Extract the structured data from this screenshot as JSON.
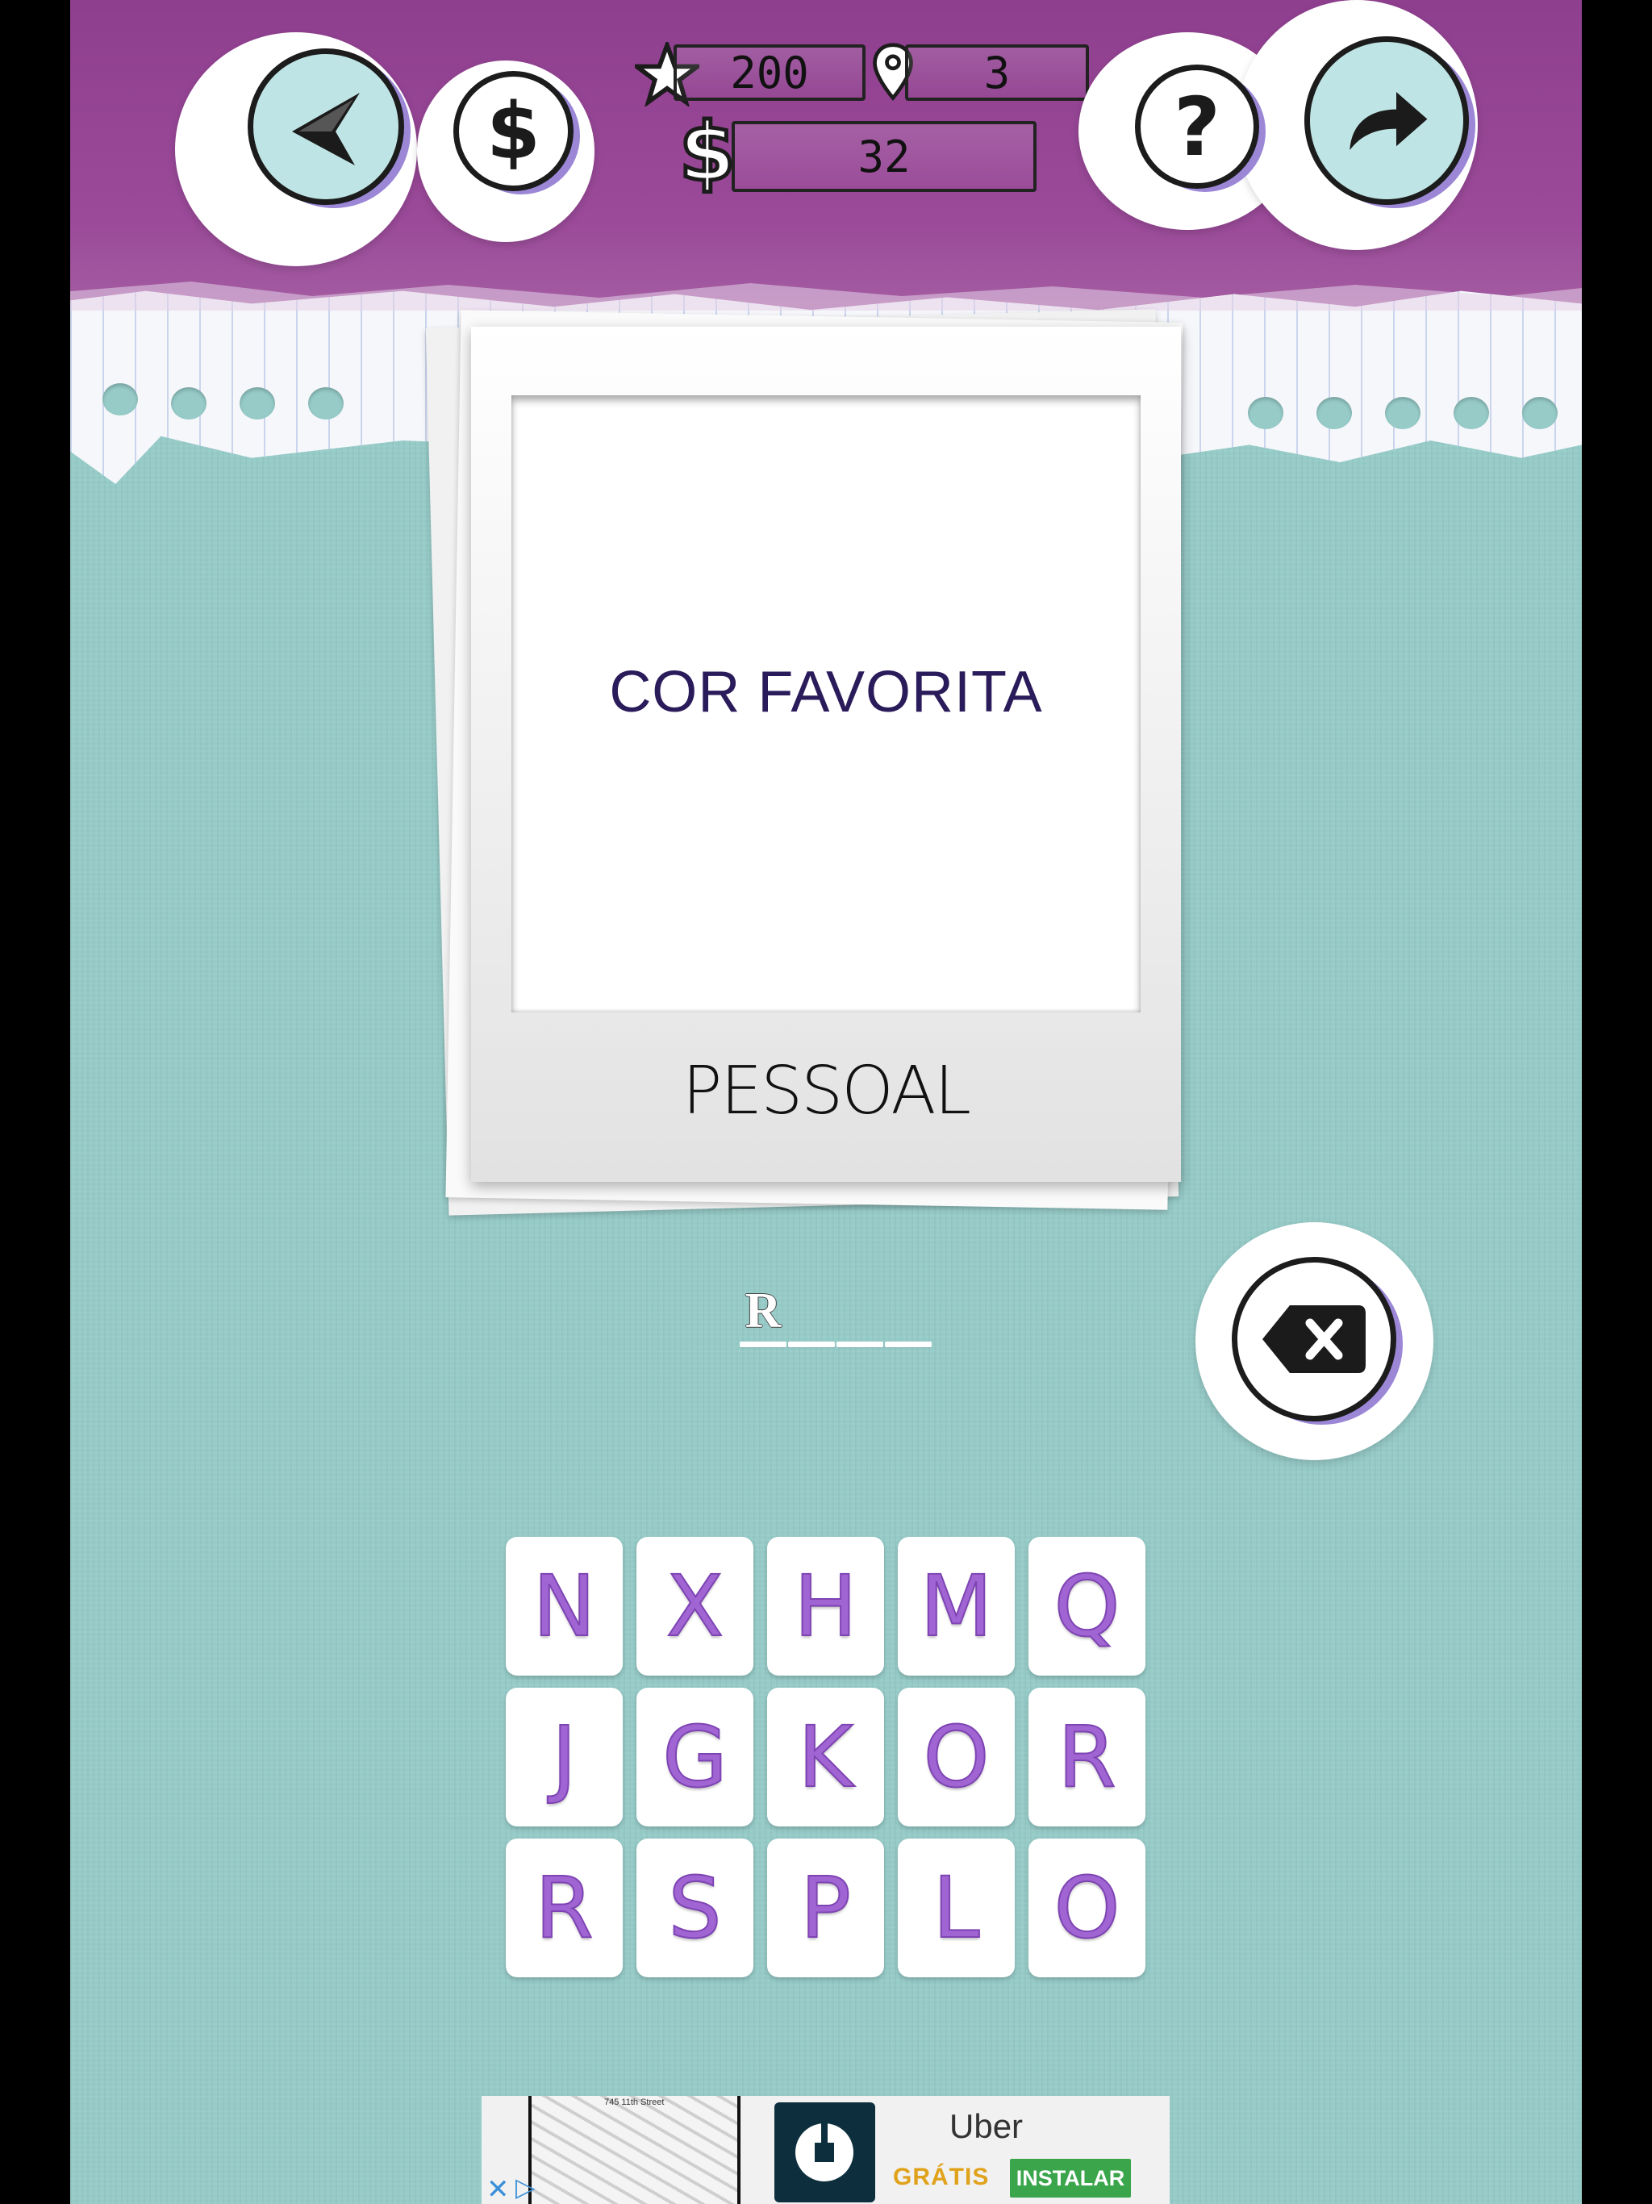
{
  "stats": {
    "stars": "200",
    "locations": "3",
    "coins": "32"
  },
  "puzzle": {
    "clue": "COR FAVORITA",
    "category": "PESSOAL"
  },
  "answer": {
    "slots": [
      "R",
      "",
      "",
      "",
      ""
    ]
  },
  "tiles": [
    "N",
    "X",
    "H",
    "M",
    "Q",
    "J",
    "G",
    "K",
    "O",
    "R",
    "R",
    "S",
    "P",
    "L",
    "O"
  ],
  "icons": {
    "back": "back-arrow-icon",
    "coins": "dollar-icon",
    "help": "question-icon",
    "skip": "skip-arrow-icon",
    "star": "star-icon",
    "pin": "location-pin-icon",
    "delete": "backspace-icon"
  },
  "ad": {
    "title": "Uber",
    "free_label": "GRÁTIS",
    "install_label": "INSTALAR",
    "map_street": "745 11th Street"
  },
  "colors": {
    "header": "#9b4a99",
    "background": "#96cbc8",
    "tile_letter": "#a065d2",
    "accent_shadow": "#9b87d6"
  }
}
